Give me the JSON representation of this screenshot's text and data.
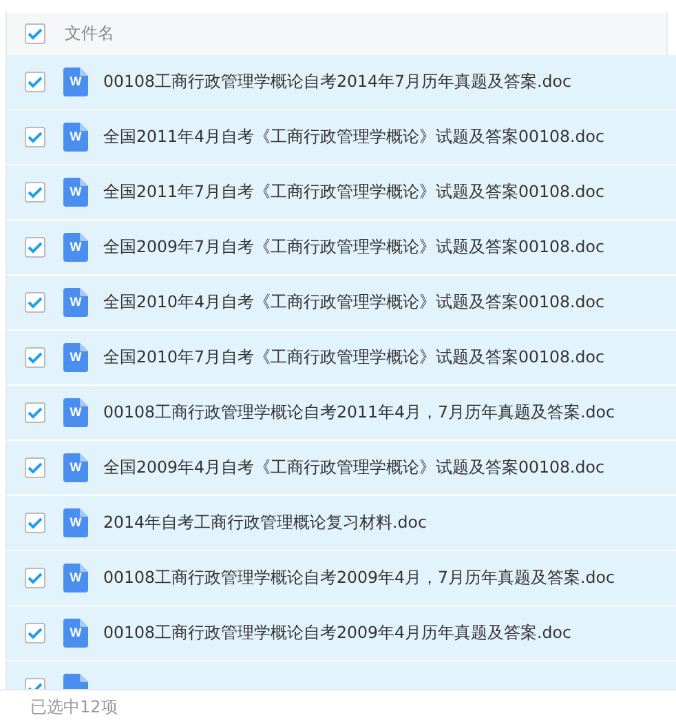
{
  "header": {
    "all_checked": true,
    "column_1": "文件名"
  },
  "files": [
    {
      "name": "00108工商行政管理学概论自考2014年7月历年真题及答案.doc",
      "icon_letter": "W",
      "checked": true
    },
    {
      "name": "全国2011年4月自考《工商行政管理学概论》试题及答案00108.doc",
      "icon_letter": "W",
      "checked": true
    },
    {
      "name": "全国2011年7月自考《工商行政管理学概论》试题及答案00108.doc",
      "icon_letter": "W",
      "checked": true
    },
    {
      "name": "全国2009年7月自考《工商行政管理学概论》试题及答案00108.doc",
      "icon_letter": "W",
      "checked": true
    },
    {
      "name": "全国2010年4月自考《工商行政管理学概论》试题及答案00108.doc",
      "icon_letter": "W",
      "checked": true
    },
    {
      "name": "全国2010年7月自考《工商行政管理学概论》试题及答案00108.doc",
      "icon_letter": "W",
      "checked": true
    },
    {
      "name": "00108工商行政管理学概论自考2011年4月，7月历年真题及答案.doc",
      "icon_letter": "W",
      "checked": true
    },
    {
      "name": "全国2009年4月自考《工商行政管理学概论》试题及答案00108.doc",
      "icon_letter": "W",
      "checked": true
    },
    {
      "name": "2014年自考工商行政管理概论复习材料.doc",
      "icon_letter": "W",
      "checked": true
    },
    {
      "name": "00108工商行政管理学概论自考2009年4月，7月历年真题及答案.doc",
      "icon_letter": "W",
      "checked": true
    },
    {
      "name": "00108工商行政管理学概论自考2009年4月历年真题及答案.doc",
      "icon_letter": "W",
      "checked": true
    },
    {
      "checked": true
    }
  ],
  "status_bar": "已选中12项"
}
